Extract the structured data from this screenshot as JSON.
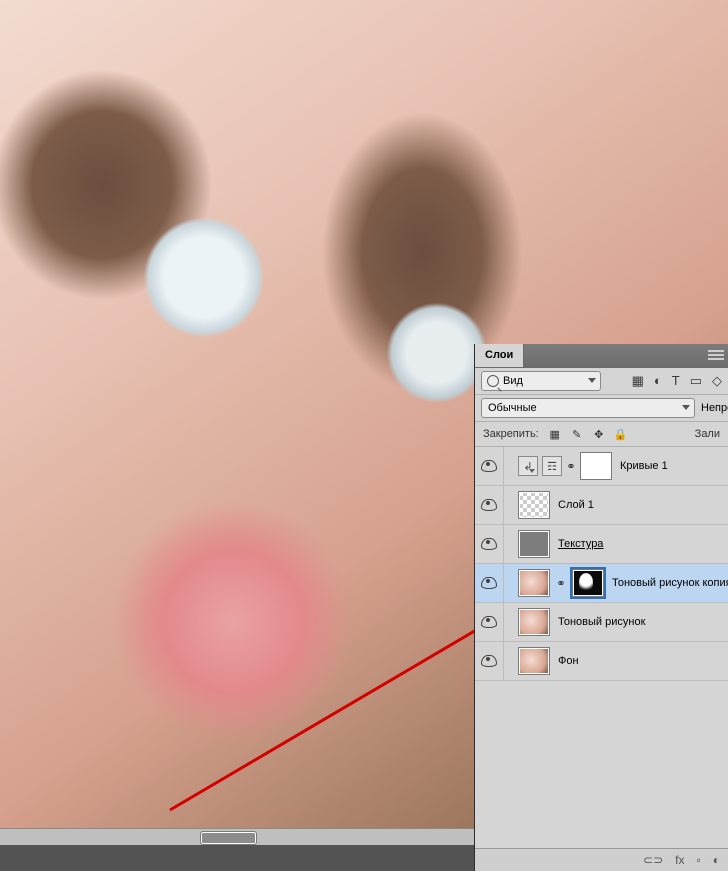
{
  "panel": {
    "tab_label": "Слои",
    "filter": {
      "label": "Вид"
    },
    "row_icons": [
      "▦",
      "◐",
      "T",
      "▭",
      "◇"
    ],
    "blend_mode": "Обычные",
    "opacity_label": "Непрозрачно",
    "lock_label": "Закрепить:",
    "fill_label": "Зали",
    "layers": [
      {
        "name": "Кривые 1",
        "type": "adjustment"
      },
      {
        "name": "Слой 1",
        "type": "transparent"
      },
      {
        "name": "Текстура",
        "type": "gray",
        "link": true
      },
      {
        "name": "Тоновый рисунок копия",
        "type": "photo",
        "mask": true,
        "selected": true
      },
      {
        "name": "Тоновый рисунок",
        "type": "photo"
      },
      {
        "name": "Фон",
        "type": "photo"
      }
    ],
    "bottom_icons": [
      "⊂⊃",
      "fx",
      "▫",
      "◐"
    ]
  }
}
